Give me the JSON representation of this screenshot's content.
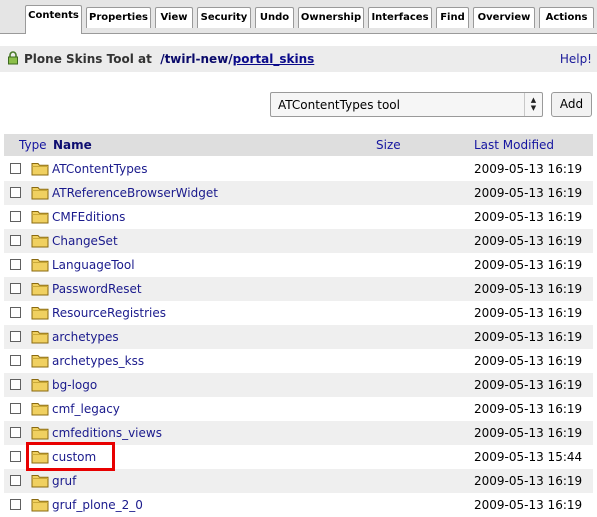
{
  "tabs": [
    {
      "label": "Contents",
      "active": true
    },
    {
      "label": "Properties",
      "active": false
    },
    {
      "label": "View",
      "active": false
    },
    {
      "label": "Security",
      "active": false
    },
    {
      "label": "Undo",
      "active": false
    },
    {
      "label": "Ownership",
      "active": false
    },
    {
      "label": "Interfaces",
      "active": false
    },
    {
      "label": "Find",
      "active": false
    },
    {
      "label": "Overview",
      "active": false
    },
    {
      "label": "Actions",
      "active": false
    }
  ],
  "title": {
    "prefix": "Plone Skins Tool at",
    "crumb_root": "/twirl-new/",
    "crumb_current": "portal_skins",
    "help": "Help!"
  },
  "add_product": {
    "selected": "ATContentTypes tool",
    "button_label": "Add"
  },
  "table": {
    "headers": {
      "type": "Type",
      "name": "Name",
      "size": "Size",
      "modified": "Last Modified"
    },
    "rows": [
      {
        "name": "ATContentTypes",
        "modified": "2009-05-13 16:19"
      },
      {
        "name": "ATReferenceBrowserWidget",
        "modified": "2009-05-13 16:19"
      },
      {
        "name": "CMFEditions",
        "modified": "2009-05-13 16:19"
      },
      {
        "name": "ChangeSet",
        "modified": "2009-05-13 16:19"
      },
      {
        "name": "LanguageTool",
        "modified": "2009-05-13 16:19"
      },
      {
        "name": "PasswordReset",
        "modified": "2009-05-13 16:19"
      },
      {
        "name": "ResourceRegistries",
        "modified": "2009-05-13 16:19"
      },
      {
        "name": "archetypes",
        "modified": "2009-05-13 16:19"
      },
      {
        "name": "archetypes_kss",
        "modified": "2009-05-13 16:19"
      },
      {
        "name": "bg-logo",
        "modified": "2009-05-13 16:19"
      },
      {
        "name": "cmf_legacy",
        "modified": "2009-05-13 16:19"
      },
      {
        "name": "cmfeditions_views",
        "modified": "2009-05-13 16:19"
      },
      {
        "name": "custom",
        "modified": "2009-05-13 15:44",
        "highlighted": true
      },
      {
        "name": "gruf",
        "modified": "2009-05-13 16:19"
      },
      {
        "name": "gruf_plone_2_0",
        "modified": "2009-05-13 16:19"
      }
    ]
  },
  "colors": {
    "folder_fill": "#f0d060",
    "highlight_border": "#e80000",
    "link": "#1a1a8c"
  },
  "icons": {
    "row_type": "folder-icon",
    "title": "lock-icon",
    "select": "updown-arrows-icon"
  }
}
